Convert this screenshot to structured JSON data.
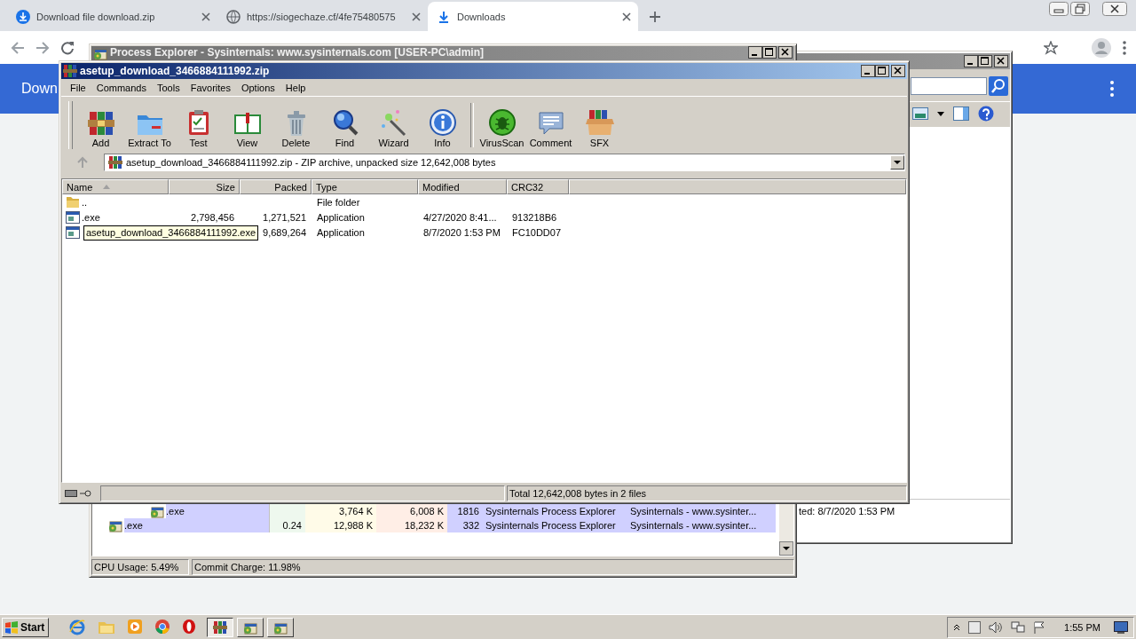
{
  "browser": {
    "tabs": [
      {
        "title": "Download file download.zip",
        "selected": false
      },
      {
        "title": "https://siogechaze.cf/4fe75480575",
        "selected": false
      },
      {
        "title": "Downloads",
        "selected": true
      }
    ],
    "page_title": "Down"
  },
  "explorer_window": {
    "active": false,
    "details": "ted: 8/7/2020 1:53 PM"
  },
  "process_explorer": {
    "title": "Process Explorer - Sysinternals: www.sysinternals.com [USER-PC\\admin]",
    "active": false,
    "rows": [
      {
        "kind": "nested",
        "name": ".exe",
        "private_bytes": "3,764 K",
        "working_set": "6,008 K",
        "pid": "1816",
        "description": "Sysinternals Process Explorer",
        "company": "Sysinternals - www.sysinter..."
      },
      {
        "kind": "top",
        "name": ".exe",
        "cpu": "0.24",
        "private_bytes": "12,988 K",
        "working_set": "18,232 K",
        "pid": "332",
        "description": "Sysinternals Process Explorer",
        "company": "Sysinternals - www.sysinter..."
      }
    ],
    "status": [
      "CPU Usage: 5.49%",
      "Commit Charge: 11.98%"
    ]
  },
  "winrar": {
    "title": "asetup_download_3466884111992.zip",
    "active": true,
    "menu": [
      "File",
      "Commands",
      "Tools",
      "Favorites",
      "Options",
      "Help"
    ],
    "toolbar": [
      "Add",
      "Extract To",
      "Test",
      "View",
      "Delete",
      "Find",
      "Wizard",
      "Info",
      "VirusScan",
      "Comment",
      "SFX"
    ],
    "address": "asetup_download_3466884111992.zip - ZIP archive, unpacked size 12,642,008 bytes",
    "columns": [
      {
        "label": "Name",
        "sorted": true
      },
      {
        "label": "Size",
        "sorted": false
      },
      {
        "label": "Packed",
        "sorted": false
      },
      {
        "label": "Type",
        "sorted": false
      },
      {
        "label": "Modified",
        "sorted": false
      },
      {
        "label": "CRC32",
        "sorted": false
      }
    ],
    "rows": [
      {
        "kind": "folder",
        "name": "..",
        "type": "File folder"
      },
      {
        "kind": "file",
        "name": ".exe",
        "size": "2,798,456",
        "packed": "1,271,521",
        "type": "Application",
        "modified": "4/27/2020 8:41...",
        "crc32": "913218B6"
      },
      {
        "kind": "file",
        "packed": "9,689,264",
        "type": "Application",
        "modified": "8/7/2020 1:53 PM",
        "crc32": "FC10DD07"
      }
    ],
    "tooltip": "asetup_download_3466884111992.exe",
    "status": "Total 12,642,008 bytes in 2 files"
  },
  "taskbar": {
    "start": "Start",
    "tasks": [
      {
        "selected": true
      },
      {
        "selected": false
      },
      {
        "selected": false
      }
    ],
    "clock": "1:55 PM"
  }
}
